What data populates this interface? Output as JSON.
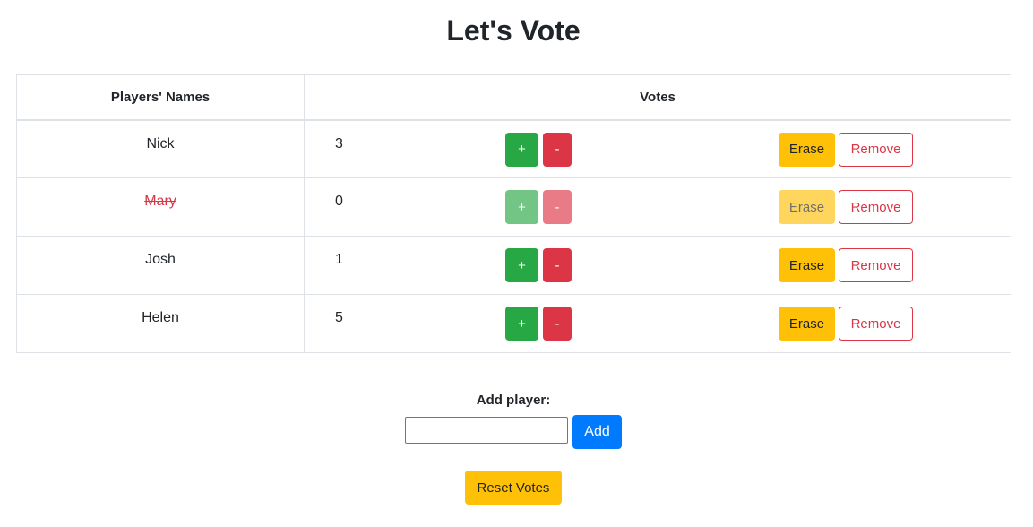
{
  "page": {
    "title": "Let's Vote"
  },
  "table": {
    "headers": {
      "names": "Players' Names",
      "votes": "Votes"
    },
    "rows": [
      {
        "name": "Nick",
        "votes": "3",
        "disabled": false
      },
      {
        "name": "Mary",
        "votes": "0",
        "disabled": true
      },
      {
        "name": "Josh",
        "votes": "1",
        "disabled": false
      },
      {
        "name": "Helen",
        "votes": "5",
        "disabled": false
      }
    ],
    "buttons": {
      "plus": "+",
      "minus": "-",
      "erase": "Erase",
      "remove": "Remove"
    }
  },
  "add_player": {
    "label": "Add player:",
    "value": "",
    "placeholder": "",
    "button": "Add"
  },
  "reset": {
    "button": "Reset Votes"
  },
  "colors": {
    "success": "#28a745",
    "danger": "#dc3545",
    "warning": "#ffc107",
    "primary": "#007bff",
    "border": "#dee2e6",
    "text": "#212529"
  }
}
